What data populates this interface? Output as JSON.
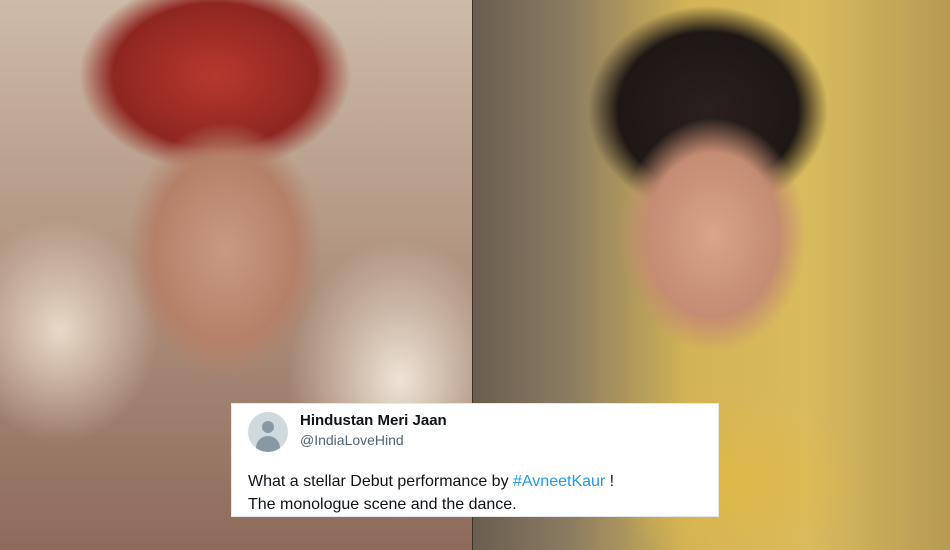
{
  "tweet": {
    "display_name": "Hindustan Meri Jaan",
    "handle": "@IndiaLoveHind",
    "text_before": "What a stellar Debut performance by ",
    "hashtag": "#AvneetKaur",
    "text_after": " !",
    "line2": "The monologue scene and the dance.",
    "hashtag_color": "#1d9bf0",
    "avatar_icon": "default-profile-avatar-icon"
  },
  "photos": {
    "left": "bride-closeup-photo",
    "right": "woman-portrait-photo"
  }
}
